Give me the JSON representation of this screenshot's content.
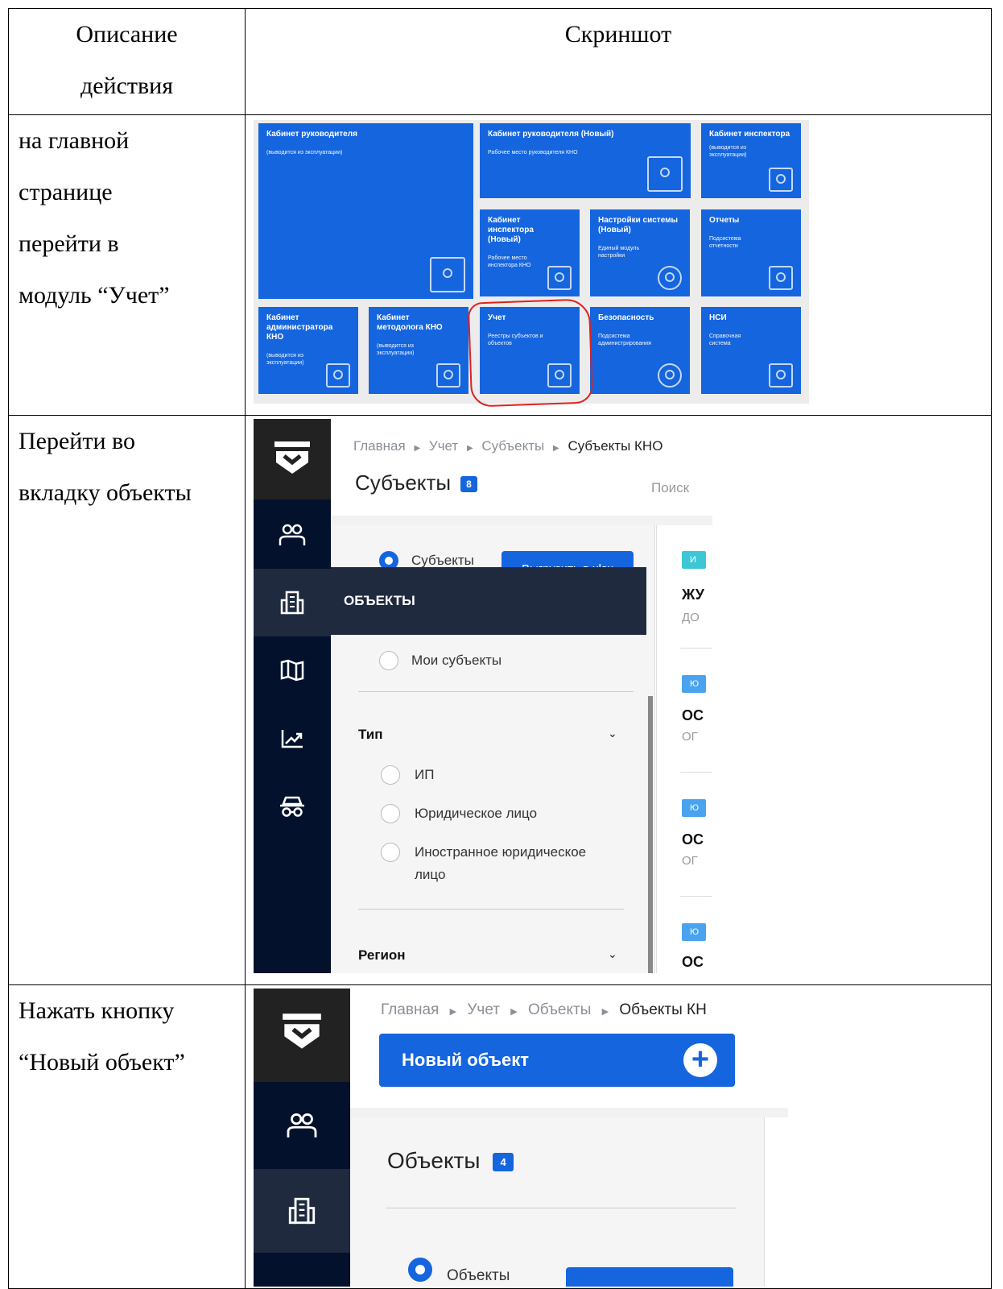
{
  "headers": {
    "col1_line1": "Описание",
    "col1_line2": "действия",
    "col2": "Скриншот"
  },
  "rows": [
    {
      "desc": [
        "на главной",
        "странице",
        "перейти в",
        "модуль “Учет”"
      ]
    },
    {
      "desc": [
        "Перейти во",
        "вкладку объекты"
      ]
    },
    {
      "desc": [
        "Нажать кнопку",
        "“Новый объект”"
      ]
    }
  ],
  "tiles": [
    {
      "title": "Кабинет руководителя",
      "sub": "(выводится из эксплуатации)"
    },
    {
      "title": "Кабинет руководителя (Новый)",
      "sub": "Рабочее место руководителя КНО"
    },
    {
      "title": "Кабинет инспектора",
      "sub": "(выводится из эксплуатации)"
    },
    {
      "title": "Кабинет инспектора (Новый)",
      "sub": "Рабочее место инспектора КНО"
    },
    {
      "title": "Настройки системы (Новый)",
      "sub": "Единый модуль настройки"
    },
    {
      "title": "Отчеты",
      "sub": "Подсистема отчетности"
    },
    {
      "title": "Кабинет администратора КНО",
      "sub": "(выводится из эксплуатации)"
    },
    {
      "title": "Кабинет методолога КНО",
      "sub": "(выводится из эксплуатации)"
    },
    {
      "title": "Учет",
      "sub": "Реестры субъектов и объектов"
    },
    {
      "title": "Безопасность",
      "sub": "Подсистема администрирования"
    },
    {
      "title": "НСИ",
      "sub": "Справочная система"
    }
  ],
  "app1": {
    "breadcrumb": [
      "Главная",
      "Учет",
      "Субъекты",
      "Субъекты КНО"
    ],
    "title": "Субъекты",
    "count": "8",
    "search_placeholder": "Поиск",
    "radio_subjects": "Субъекты",
    "xlsx_button": "Выгрузить в xlsx",
    "tooltip": "ОБЪЕКТЫ",
    "radio_my": "Мои субъекты",
    "type_head": "Тип",
    "type_options": [
      "ИП",
      "Юридическое лицо",
      "Иностранное юридическое",
      "лицо"
    ],
    "region_head": "Регион",
    "list_chips": [
      "И",
      "Ю",
      "Ю",
      "Ю"
    ],
    "list_texts": [
      "ЖУ",
      "ОС",
      "ОС",
      "ОС"
    ],
    "list_subs": [
      "ДО",
      "ОГ",
      "ОГ"
    ],
    "chip_colors": [
      "#3dc6d6",
      "#4aa3ee"
    ]
  },
  "app2": {
    "breadcrumb": [
      "Главная",
      "Учет",
      "Объекты",
      "Объекты КН"
    ],
    "new_button": "Новый объект",
    "title": "Объекты",
    "count": "4",
    "radio_objects": "Объекты"
  },
  "colors": {
    "primary": "#1565df",
    "sidebar": "#03112c",
    "highlight": "#e02020"
  }
}
